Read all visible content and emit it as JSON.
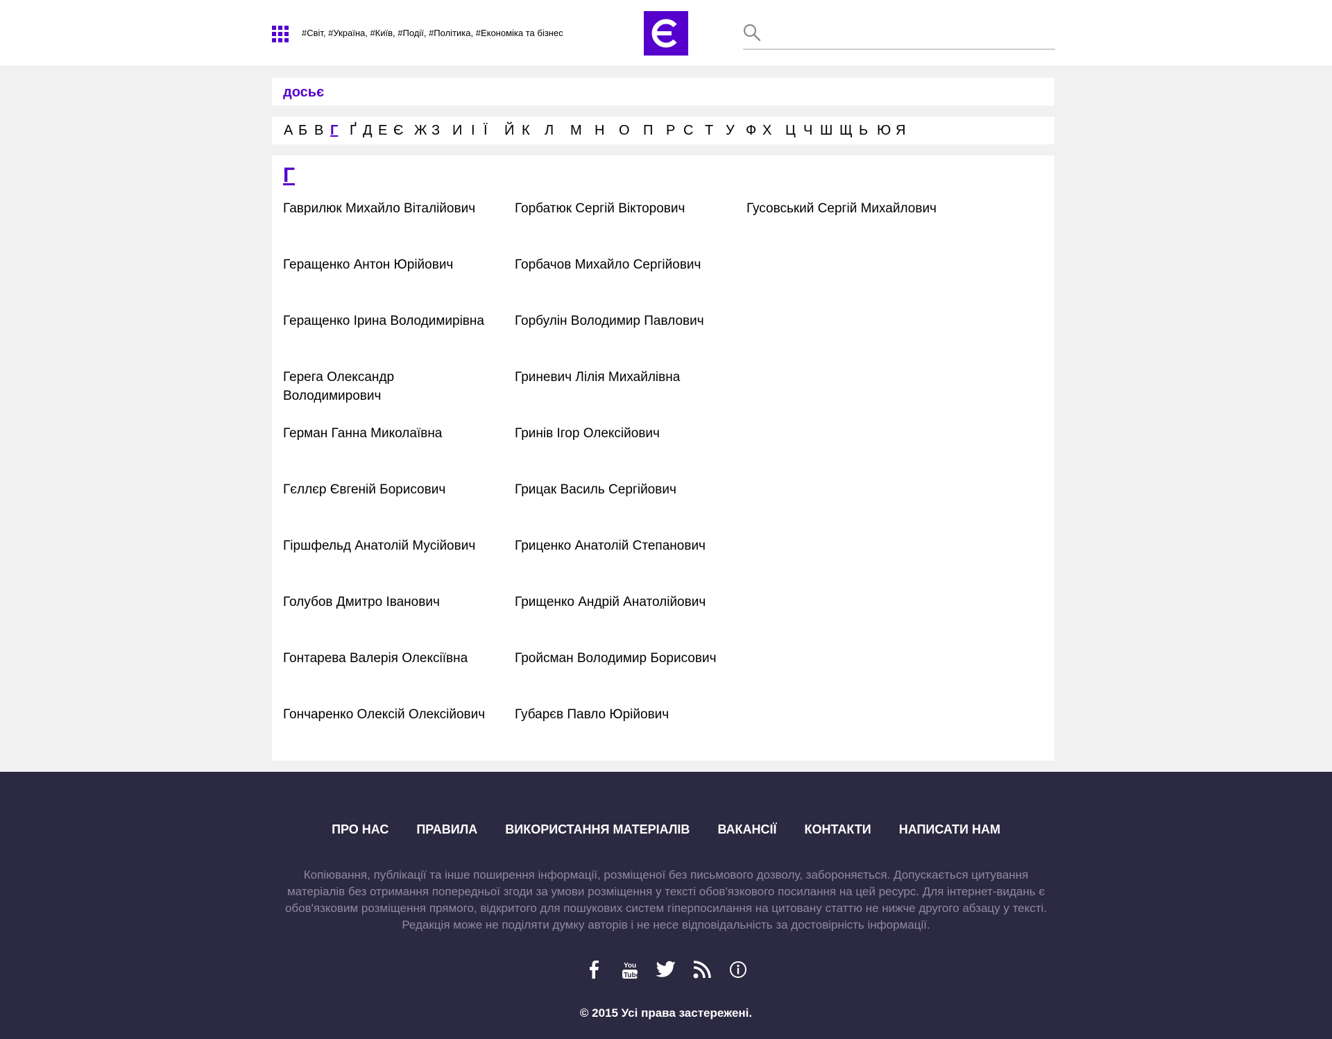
{
  "header": {
    "tags": "#Світ, #Україна, #Київ, #Події, #Політика, #Економіка та бізнес",
    "logo_letter": "Є",
    "search_placeholder": ""
  },
  "section_title": "досьє",
  "alphabet": {
    "active": "Г",
    "letters": [
      "А",
      "Б",
      "В",
      "Г",
      "Ґ",
      "Д",
      "Е",
      "Є",
      "Ж",
      "З",
      "И",
      "І",
      "Ї",
      "Й",
      "К",
      "Л",
      "М",
      "Н",
      "О",
      "П",
      "Р",
      "С",
      "Т",
      "У",
      "Ф",
      "Х",
      "Ц",
      "Ч",
      "Ш",
      "Щ",
      "Ь",
      "Ю",
      "Я"
    ]
  },
  "list": {
    "letter": "Г",
    "columns": [
      [
        "Гаврилюк Михайло Віталійович",
        "Геращенко Антон Юрійович",
        "Геращенко Ірина Володимирівна",
        "Герега Олександр Володимирович",
        "Герман Ганна Миколаївна",
        "Гєллєр Євгеній Борисович",
        "Гіршфельд Анатолій Мусійович",
        "Голубов Дмитро Іванович",
        "Гонтарева Валерія Олексіївна",
        "Гончаренко Олексій Олексійович"
      ],
      [
        "Горбатюк Сергій Вікторович",
        "Горбачов Михайло Сергійович",
        "Горбулін Володимир Павлович",
        "Гриневич Лілія Михайлівна",
        "Гринів Ігор Олексійович",
        "Грицак Василь Сергійович",
        "Гриценко Анатолій Степанович",
        "Грищенко Андрій Анатолійович",
        "Гройсман Володимир Борисович",
        "Губарєв Павло Юрійович"
      ],
      [
        "Гусовський Сергій Михайлович"
      ]
    ]
  },
  "footer": {
    "nav": [
      "ПРО НАС",
      "ПРАВИЛА",
      "ВИКОРИСТАННЯ МАТЕРІАЛІВ",
      "ВАКАНСІЇ",
      "КОНТАКТИ",
      "НАПИСАТИ НАМ"
    ],
    "disclaimer": "Копіювання, публікації та інше поширення інформації, розміщеної без письмового дозволу, забороняється. Допускається цитування матеріалів без отримання попередньої згоди за умови розміщення у тексті обов'язкового посилання на цей ресурс. Для інтернет-видань є обов'язковим розміщення прямого, відкритого для пошукових систем гіперпосилання на цитовану статтю не нижче другого абзацу у тексті. Редакція може не поділяти думку авторів і не несе відповідальність за достовірність інформації.",
    "social_icons": [
      "facebook-icon",
      "youtube-icon",
      "twitter-icon",
      "rss-icon",
      "info-icon"
    ],
    "copyright": "© 2015 Усі права застережені."
  },
  "colors": {
    "accent": "#5500cc",
    "footer_bg": "#2c2942",
    "page_bg": "#f1f1f1"
  }
}
